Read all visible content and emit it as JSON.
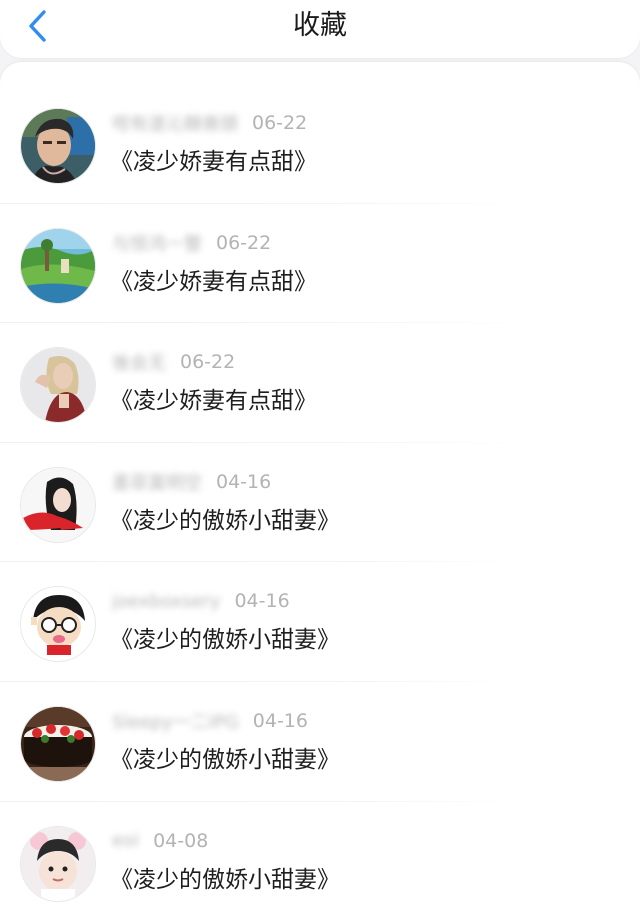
{
  "header": {
    "title": "收藏",
    "back_icon": "chevron-left-icon",
    "accent_color": "#2f8cf0"
  },
  "favorites": [
    {
      "username": "咁有遂沁棘兽頭",
      "date": "06-22",
      "book": "《凌少娇妻有点甜》",
      "avatar_icon": "avatar-man-icon"
    },
    {
      "username": "与惊鸿一瞥",
      "date": "06-22",
      "book": "《凌少娇妻有点甜》",
      "avatar_icon": "avatar-landscape-icon"
    },
    {
      "username": "後会无",
      "date": "06-22",
      "book": "《凌少娇妻有点甜》",
      "avatar_icon": "avatar-woman-icon"
    },
    {
      "username": "墨菲寞明空",
      "date": "04-16",
      "book": "《凌少的傲娇小甜妻》",
      "avatar_icon": "avatar-girl-illustration-icon"
    },
    {
      "username": "joexboxsery",
      "date": "04-16",
      "book": "《凌少的傲娇小甜妻》",
      "avatar_icon": "avatar-cartoon-icon"
    },
    {
      "username": "Sleepy一二IPG",
      "date": "04-16",
      "book": "《凌少的傲娇小甜妻》",
      "avatar_icon": "avatar-cake-icon"
    },
    {
      "username": "eoi",
      "date": "04-08",
      "book": "《凌少的傲娇小甜妻》",
      "avatar_icon": "avatar-child-icon"
    }
  ]
}
